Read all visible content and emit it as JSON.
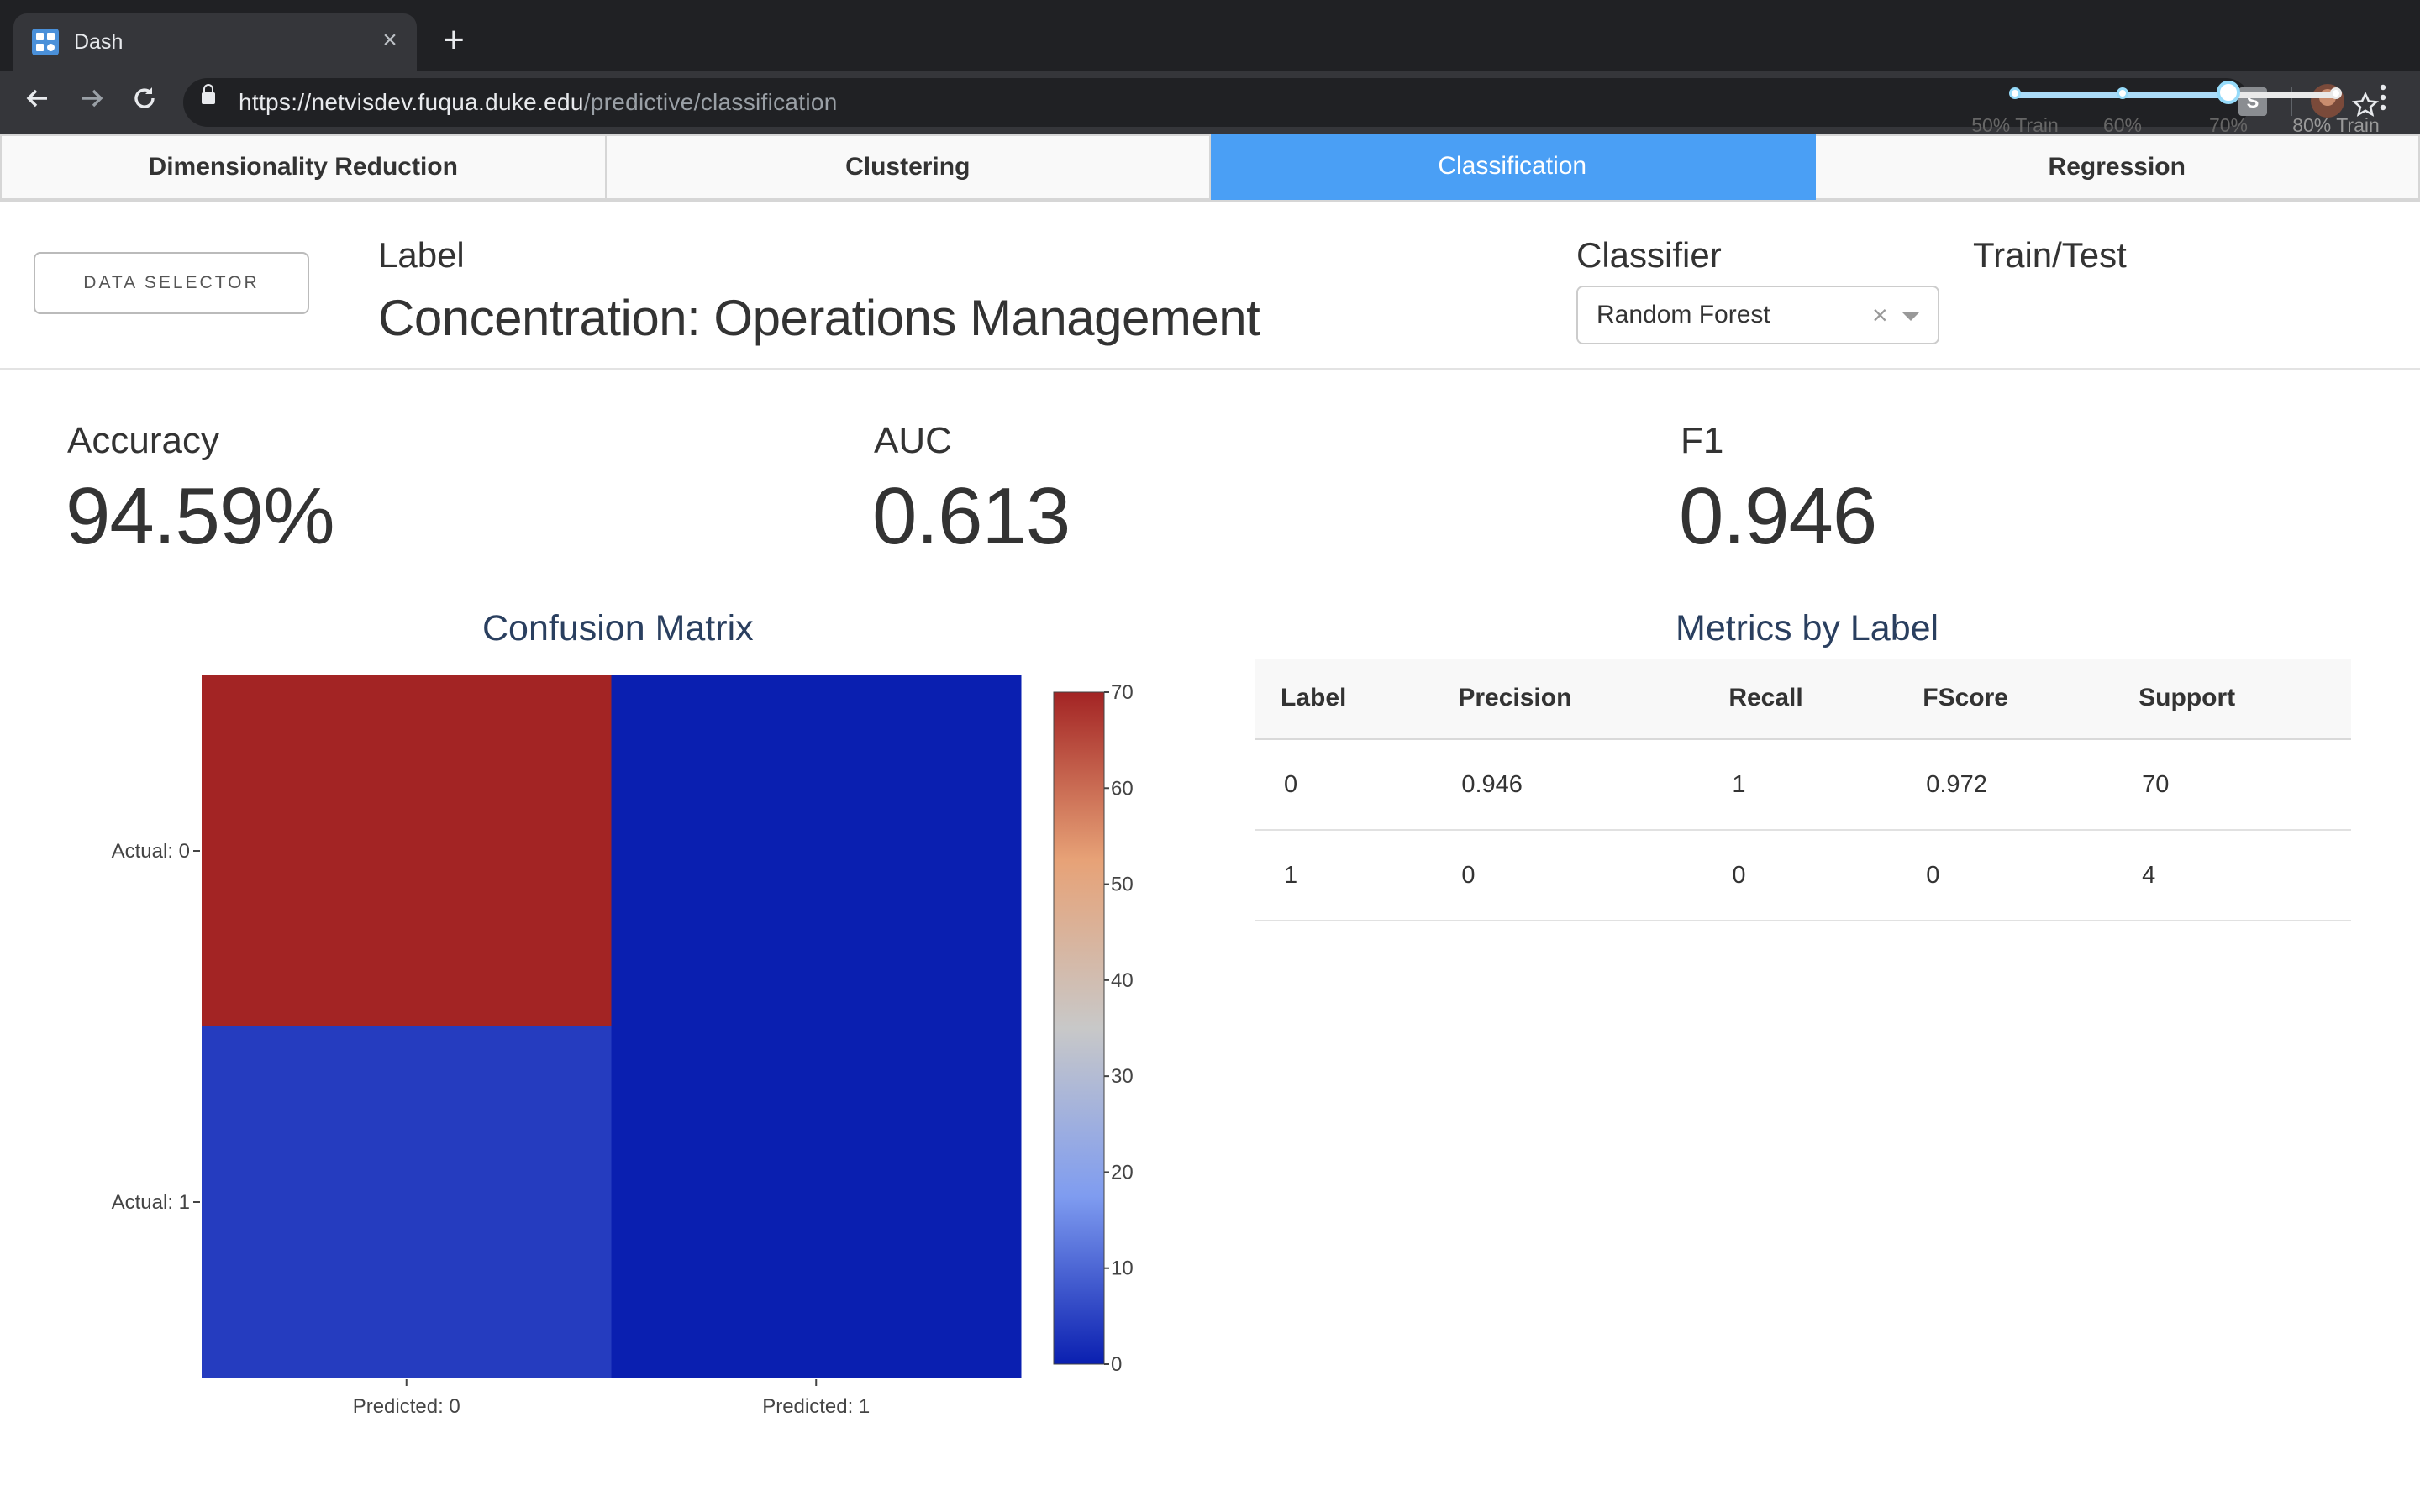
{
  "browser": {
    "tab_title": "Dash",
    "tab_close": "×",
    "new_tab": "+",
    "url_host": "https://netvisdev.fuqua.duke.edu",
    "url_path": "/predictive/classification",
    "extension_label": "S"
  },
  "nav_tabs": [
    {
      "label": "Dimensionality Reduction",
      "active": false
    },
    {
      "label": "Clustering",
      "active": false
    },
    {
      "label": "Classification",
      "active": true
    },
    {
      "label": "Regression",
      "active": false
    }
  ],
  "controls": {
    "data_selector_label": "DATA SELECTOR",
    "label_caption": "Label",
    "label_value": "Concentration: Operations Management",
    "classifier_caption": "Classifier",
    "classifier_value": "Random Forest",
    "clear_glyph": "×",
    "train_test_caption": "Train/Test",
    "slider_marks": [
      "50% Train",
      "60%",
      "70%",
      "80% Train"
    ],
    "slider_value": "70%"
  },
  "metrics": {
    "accuracy_label": "Accuracy",
    "accuracy_value": "94.59%",
    "auc_label": "AUC",
    "auc_value": "0.613",
    "f1_label": "F1",
    "f1_value": "0.946"
  },
  "chart_data": {
    "type": "heatmap",
    "title": "Confusion Matrix",
    "x_categories": [
      "Predicted: 0",
      "Predicted: 1"
    ],
    "y_categories": [
      "Actual: 0",
      "Actual: 1"
    ],
    "z": [
      [
        70,
        0
      ],
      [
        4,
        0
      ]
    ],
    "colorscale": [
      "#0a1fb0",
      "#7f9cf0",
      "#c8c8c8",
      "#e7a277",
      "#a32424"
    ],
    "zmin": 0,
    "zmax": 70,
    "colorbar_ticks": [
      0,
      10,
      20,
      30,
      40,
      50,
      60,
      70
    ]
  },
  "metrics_table": {
    "title": "Metrics by Label",
    "columns": [
      "Label",
      "Precision",
      "Recall",
      "FScore",
      "Support"
    ],
    "rows": [
      [
        "0",
        "0.946",
        "1",
        "0.972",
        "70"
      ],
      [
        "1",
        "0",
        "0",
        "0",
        "4"
      ]
    ]
  }
}
